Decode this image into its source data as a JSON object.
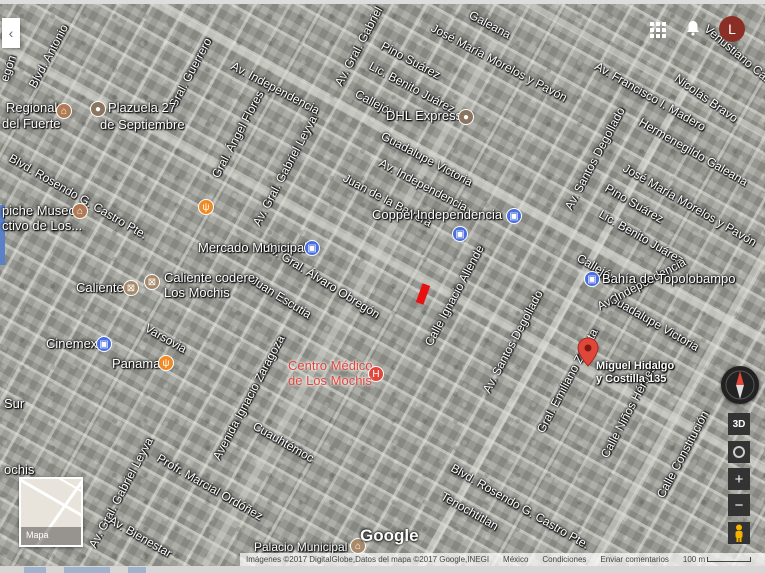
{
  "map": {
    "type": "satellite",
    "street_labels": [
      {
        "text": "Blvd. Antonio",
        "style": ""
      },
      {
        "text": "egón",
        "style": ""
      },
      {
        "text": "Gral. Guerrero",
        "style": ""
      },
      {
        "text": "Av. Independencia",
        "style": ""
      },
      {
        "text": "Av. Gral. Gabriel",
        "style": ""
      },
      {
        "text": "Pino Suárez",
        "style": ""
      },
      {
        "text": "Lic. Benito Juárez",
        "style": ""
      },
      {
        "text": "Callejón",
        "style": ""
      },
      {
        "text": "José María Morelos y Pavón",
        "style": ""
      },
      {
        "text": "Galeana",
        "style": ""
      },
      {
        "text": "Venustiano Carranza",
        "style": ""
      },
      {
        "text": "Av. Francisco I. Madero",
        "style": ""
      },
      {
        "text": "Nicolás Bravo",
        "style": ""
      },
      {
        "text": "Hermenegildo Galeana",
        "style": ""
      },
      {
        "text": "Av. Santos Degollado",
        "style": ""
      },
      {
        "text": "José María Morelos y Pavón",
        "style": ""
      },
      {
        "text": "Pino Suárez",
        "style": ""
      },
      {
        "text": "Lic. Benito Juárez",
        "style": ""
      },
      {
        "text": "Callejón",
        "style": ""
      },
      {
        "text": "Guadalupe Victoria",
        "style": ""
      },
      {
        "text": "Av. Independencia",
        "style": ""
      },
      {
        "text": "Gral. Ángel Flores",
        "style": ""
      },
      {
        "text": "Av. Gral. Gabriel Leyva",
        "style": ""
      },
      {
        "text": "Juan de la Barrera",
        "style": ""
      },
      {
        "text": "Blvd. Rosendo G. Castro Pte.",
        "style": ""
      },
      {
        "text": "Av. Gral. Álvaro Obregón",
        "style": ""
      },
      {
        "text": "Juan Escutia",
        "style": ""
      },
      {
        "text": "Varsovia",
        "style": ""
      },
      {
        "text": "Calle Ignacio Allende",
        "style": ""
      },
      {
        "text": "Av. Santos Degollado",
        "style": ""
      },
      {
        "text": "Guadalupe Victoria",
        "style": ""
      },
      {
        "text": "Av. Independencia",
        "style": ""
      },
      {
        "text": "Gral. Emiliano Zapata",
        "style": ""
      },
      {
        "text": "Calle Niños Héroes",
        "style": ""
      },
      {
        "text": "Calle Constitución",
        "style": ""
      },
      {
        "text": "Avenida Ignacio Zaragoza",
        "style": ""
      },
      {
        "text": "Cuauhtémoc",
        "style": ""
      },
      {
        "text": "Av. Gral. Gabriel Leyva",
        "style": ""
      },
      {
        "text": "Profr. Marcial Ordóñez",
        "style": ""
      },
      {
        "text": "Av. Bienestar",
        "style": ""
      },
      {
        "text": "Blvd. Rosendo G. Castro Pte.",
        "style": ""
      },
      {
        "text": "Tenochtitlan",
        "style": ""
      }
    ],
    "place_labels": [
      {
        "text": "Plazuela 27",
        "icon": "generic"
      },
      {
        "text": "de Septiembre",
        "icon": ""
      },
      {
        "text": "Regional",
        "icon": "museum"
      },
      {
        "text": "del Fuerte",
        "icon": ""
      },
      {
        "text": "DHL Express",
        "icon": "generic"
      },
      {
        "text": "Coppel Independencia",
        "icon": "shop"
      },
      {
        "text": "Mercado Municipal",
        "icon": "shop"
      },
      {
        "text": "Bahía de Topolobampo",
        "icon": "shop"
      },
      {
        "text": "piche Museo",
        "icon": "museum"
      },
      {
        "text": "ctivo de Los...",
        "icon": ""
      },
      {
        "text": "Caliente",
        "icon": "venue"
      },
      {
        "text": "Caliente codere",
        "icon": "venue"
      },
      {
        "text": "Los Mochis",
        "icon": ""
      },
      {
        "text": "Cinemex",
        "icon": "shop"
      },
      {
        "text": "Panama",
        "icon": "food"
      },
      {
        "text": "Centro Médico",
        "icon": "health"
      },
      {
        "text": "de Los Mochis",
        "icon": ""
      },
      {
        "text": "Sur",
        "icon": ""
      },
      {
        "text": "ochis",
        "icon": ""
      },
      {
        "text": "Palacio Municipal",
        "icon": "venue"
      }
    ],
    "pin_label_line1": "Miguel Hidalgo",
    "pin_label_line2": "y Costilla 135",
    "pin_color": "#e0473a"
  },
  "top_bar": {
    "back_icon": "chevron-left-icon",
    "avatar_letter": "L",
    "avatar_color": "#8b2f26"
  },
  "controls": {
    "map_thumb_label": "Mapa",
    "label_3d": "3D",
    "zoom_in": "+",
    "zoom_out": "−"
  },
  "footer": {
    "google": "Google",
    "imagery": "Imágenes ©2017 DigitalGlobe,Datos del mapa ©2017 Google,INEGI",
    "country": "México",
    "terms": "Condiciones",
    "feedback": "Enviar comentarios",
    "scale": "100 m"
  }
}
